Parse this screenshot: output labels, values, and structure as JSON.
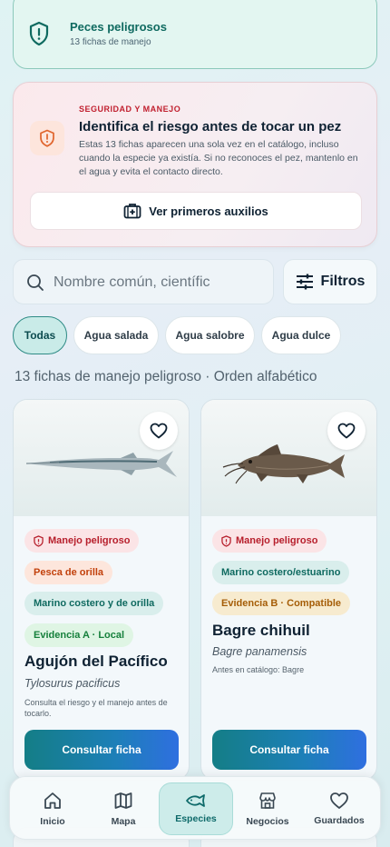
{
  "top_card": {
    "title": "Peces peligrosos",
    "subtitle": "13 fichas de manejo",
    "icon": "shield-icon"
  },
  "safety": {
    "kicker": "SEGURIDAD Y MANEJO",
    "heading": "Identifica el riesgo antes de tocar un pez",
    "description": "Estas 13 fichas aparecen una sola vez en el catálogo, incluso cuando la especie ya existía. Si no reconoces el pez, mantenlo en el agua y evita el contacto directo.",
    "button_label": "Ver primeros auxilios",
    "icon": "alert-shield-icon"
  },
  "search": {
    "placeholder": "Nombre común, científic",
    "value": ""
  },
  "filters_label": "Filtros",
  "chips": [
    {
      "label": "Todas",
      "active": true
    },
    {
      "label": "Agua salada",
      "active": false
    },
    {
      "label": "Agua salobre",
      "active": false
    },
    {
      "label": "Agua dulce",
      "active": false
    }
  ],
  "list_meta": "13 fichas de manejo peligroso · Orden alfabético",
  "cards": [
    {
      "tags": [
        "Manejo peligroso",
        "Pesca de orilla",
        "Marino costero y de orilla",
        "Evidencia A · Local"
      ],
      "name": "Agujón del Pacífico",
      "scientific": "Tylosurus pacificus",
      "note": "Consulta el riesgo y el manejo antes de tocarlo.",
      "cta": "Consultar ficha"
    },
    {
      "tags": [
        "Manejo peligroso",
        "Marino costero/estuarino",
        "Evidencia B · Compatible"
      ],
      "name": "Bagre chihuil",
      "scientific": "Bagre panamensis",
      "note": "Antes en catálogo: Bagre",
      "cta": "Consultar ficha"
    }
  ],
  "nav": [
    {
      "label": "Inicio",
      "icon": "home-icon",
      "active": false
    },
    {
      "label": "Mapa",
      "icon": "map-icon",
      "active": false
    },
    {
      "label": "Especies",
      "icon": "fish-icon",
      "active": true
    },
    {
      "label": "Negocios",
      "icon": "store-icon",
      "active": false
    },
    {
      "label": "Guardados",
      "icon": "heart-icon",
      "active": false
    }
  ],
  "colors": {
    "accent": "#0f6a60",
    "danger": "#b71f2c",
    "cta_start": "#147e86",
    "cta_end": "#2f6fe0"
  }
}
